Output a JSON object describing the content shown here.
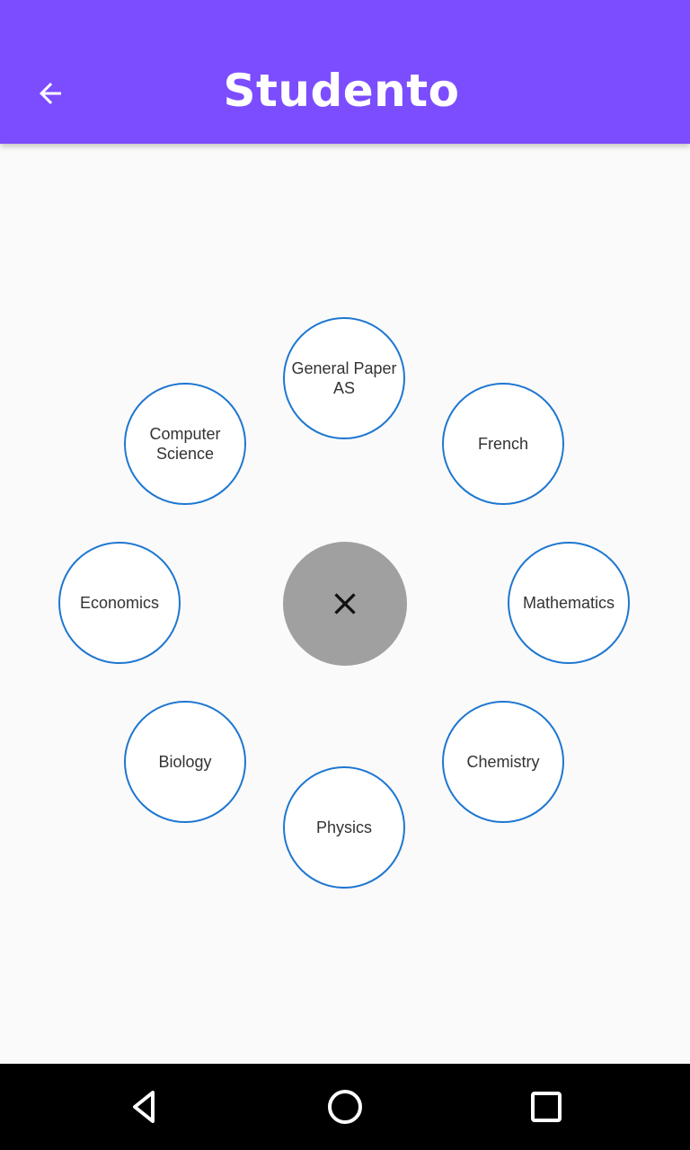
{
  "appbar": {
    "title": "Studento",
    "back_icon": "arrow-left-icon",
    "background_color": "#7c4dff"
  },
  "subjects": [
    {
      "label": "General Paper AS"
    },
    {
      "label": "French"
    },
    {
      "label": "Mathematics"
    },
    {
      "label": "Chemistry"
    },
    {
      "label": "Physics"
    },
    {
      "label": "Biology"
    },
    {
      "label": "Economics"
    },
    {
      "label": "Computer Science"
    }
  ],
  "close_button": {
    "icon": "close-icon",
    "background_color": "#a0a0a0"
  },
  "subject_border_color": "#1e77d0",
  "system_nav": {
    "back_icon": "triangle-back-icon",
    "home_icon": "circle-home-icon",
    "recents_icon": "square-recents-icon"
  }
}
